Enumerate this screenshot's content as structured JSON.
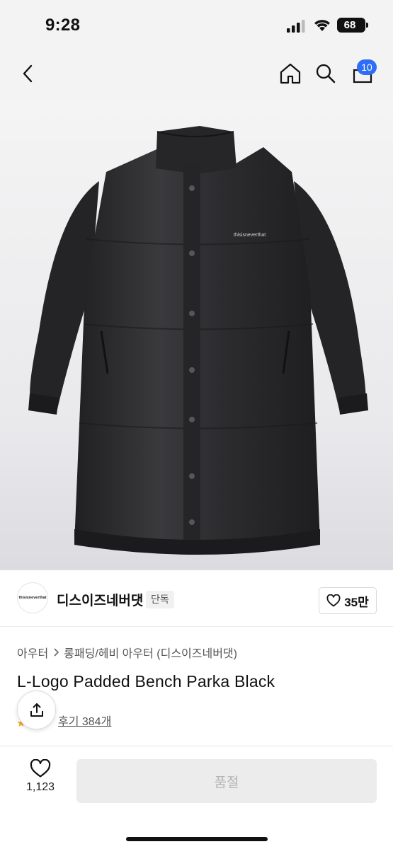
{
  "status": {
    "time": "9:28",
    "battery": "68"
  },
  "header": {
    "cart_count": "10",
    "back_icon": "chevron-left-icon",
    "home_icon": "home-icon",
    "search_icon": "search-icon",
    "cart_icon": "shopping-bag-icon"
  },
  "product_image": {
    "brand_text": "thisisneverthat"
  },
  "brand": {
    "logo_text": "thisisneverthat",
    "name": "디스이즈네버댓",
    "badge": "단독",
    "likes": "35만"
  },
  "product": {
    "breadcrumb": [
      "아우터",
      "롱패딩/헤비 아우터 (디스이즈네버댓)"
    ],
    "title": "L-Logo Padded Bench Parka Black",
    "reviews": "후기 384개"
  },
  "bottom": {
    "wish_count": "1,123",
    "buy_label": "품절"
  },
  "colors": {
    "accent": "#2e6df6",
    "disabled_bg": "#ececec",
    "disabled_text": "#b4b4b4"
  }
}
